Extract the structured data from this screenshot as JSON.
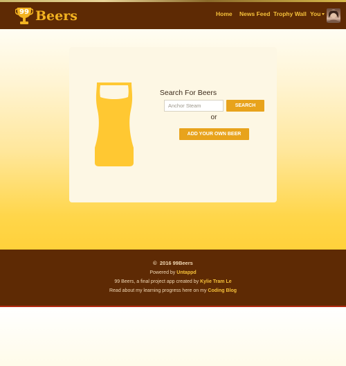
{
  "brand": {
    "badge_number": "99",
    "name": "Beers",
    "logo_icon": "trophy-icon"
  },
  "nav": {
    "items": [
      {
        "label": "Home"
      },
      {
        "label": "News Feed"
      },
      {
        "label": "Trophy Wall"
      },
      {
        "label": "You"
      }
    ],
    "you_dropdown_icon": "caret-down-icon",
    "avatar": "user-avatar"
  },
  "search": {
    "title": "Search For Beers",
    "input_value": "",
    "placeholder": "Anchor Steam",
    "button_label": "SEARCH",
    "or_text": "or",
    "add_button_label": "ADD YOUR OWN BEER",
    "illustration_icon": "beer-glass-icon"
  },
  "footer": {
    "copyright_symbol": "©",
    "copyright_text": "2016 99Beers",
    "powered_prefix": "Powered by ",
    "powered_link": "Untappd",
    "project_prefix": "99 Beers, a final project app created by ",
    "author_link": "Kylie Tram Le",
    "blog_prefix": "Read about my learning progress here on my ",
    "blog_link": "Coding Blog"
  },
  "colors": {
    "navbar": "#5e2a04",
    "brand_gold": "#f3b321",
    "button": "#e8a31c",
    "beer": "#ffc832",
    "card": "#fdf7e4"
  }
}
